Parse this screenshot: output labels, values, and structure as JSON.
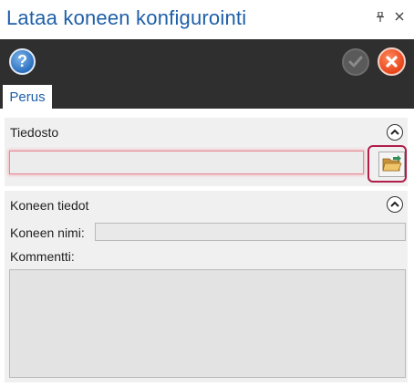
{
  "window": {
    "title": "Lataa koneen konfigurointi",
    "pin_glyph": "⎕",
    "close_glyph": "×"
  },
  "toolbar": {
    "help_icon": "help-icon",
    "help_glyph": "?",
    "ok_icon": "checkmark-icon",
    "ok_enabled": false,
    "cancel_icon": "close-icon"
  },
  "tabs": [
    {
      "label": "Perus",
      "active": true
    }
  ],
  "file_section": {
    "title": "Tiedosto",
    "file_value": "",
    "browse_icon": "folder-open-icon"
  },
  "machine_section": {
    "title": "Koneen tiedot",
    "name_label": "Koneen nimi:",
    "name_value": "",
    "comment_label": "Kommentti:",
    "comment_value": ""
  },
  "colors": {
    "title_blue": "#1e5fa8",
    "toolbar_dark": "#2f2f2f",
    "validation_red": "#e58a94",
    "highlight_border": "#b01d4a",
    "cancel_orange": "#e8441a"
  }
}
